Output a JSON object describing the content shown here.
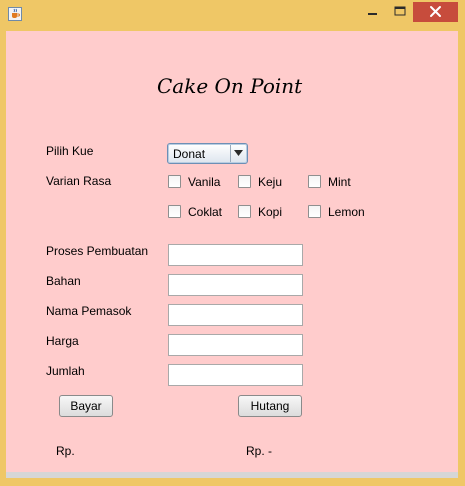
{
  "window": {
    "icon": "java-cup-icon",
    "controls": [
      "minimize-icon",
      "maximize-icon",
      "close-icon"
    ],
    "frame_color": "#efc766",
    "close_color": "#c74c3c"
  },
  "form": {
    "background": "#ffcccc",
    "title": "Cake On Point",
    "pilih_kue_label": "Pilih Kue",
    "pilih_kue_value": "Donat",
    "varian_rasa_label": "Varian Rasa",
    "flavors": [
      "Vanila",
      "Keju",
      "Mint",
      "Coklat",
      "Kopi",
      "Lemon"
    ],
    "fields": {
      "proses_label": "Proses Pembuatan",
      "proses_value": "",
      "bahan_label": "Bahan",
      "bahan_value": "",
      "pemasok_label": "Nama Pemasok",
      "pemasok_value": "",
      "harga_label": "Harga",
      "harga_value": "",
      "jumlah_label": "Jumlah",
      "jumlah_value": ""
    },
    "bayar_button": "Bayar",
    "hutang_button": "Hutang",
    "bayar_result": "Rp.",
    "hutang_result": "Rp. -"
  }
}
